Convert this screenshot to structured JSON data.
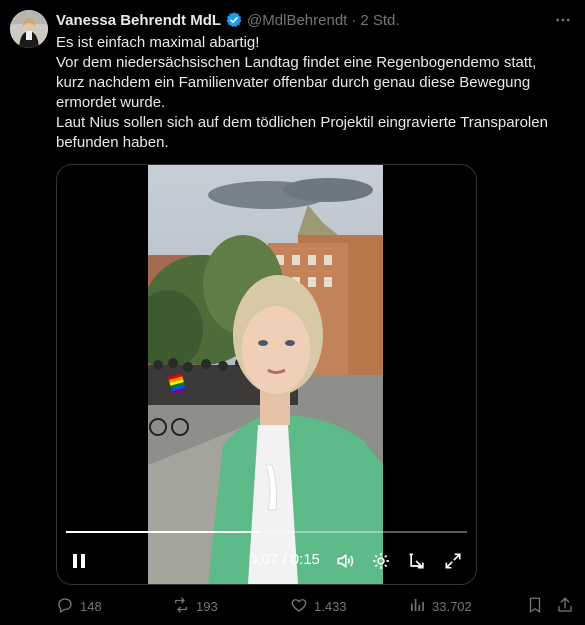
{
  "author": {
    "name": "Vanessa Behrendt MdL",
    "handle": "@MdlBehrendt",
    "separator": "·",
    "time": "2 Std.",
    "verified_color": "#1d9bf0"
  },
  "tweet": {
    "lines": [
      "Es ist einfach maximal abartig!",
      "Vor dem niedersächsischen Landtag findet eine Regenbogendemo statt,",
      "kurz nachdem ein Familienvater offenbar durch genau diese Bewegung",
      "ermordet wurde.",
      "Laut Nius sollen sich auf dem tödlichen Projektil eingravierte Transparolen",
      "befunden haben."
    ]
  },
  "video": {
    "time_label": "0:07 / 0:15",
    "progress_fraction": 0.48,
    "controls": [
      "pause-icon",
      "volume-icon",
      "settings-icon",
      "picture-in-picture-icon",
      "fullscreen-icon"
    ]
  },
  "actions": {
    "replies": "148",
    "reposts": "193",
    "likes": "1.433",
    "views": "33.702"
  },
  "colors": {
    "text": "#e7e9ea",
    "muted": "#71767b",
    "accent": "#1d9bf0",
    "background": "#000000"
  }
}
